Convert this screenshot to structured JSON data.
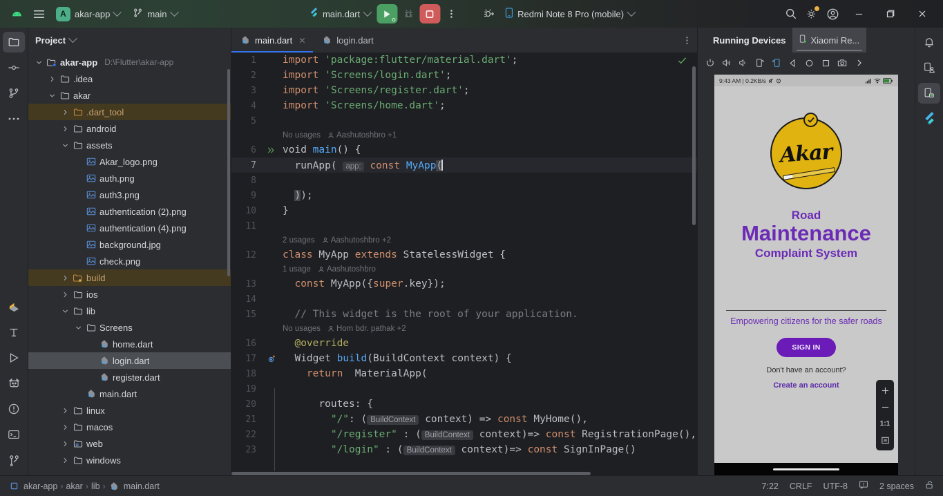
{
  "titlebar": {
    "logo_icon": "android-studio-icon",
    "menu_icon": "hamburger-menu-icon",
    "project_badge": "A",
    "project_name": "akar-app",
    "branch_icon": "git-branch-icon",
    "branch_name": "main",
    "run_config": "main.dart",
    "run_icon": "run-play-icon",
    "debug_icon": "debug-bug-icon",
    "stop_icon": "stop-square-icon",
    "more_icon": "more-vertical-icon",
    "attach_debug_icon": "attach-debugger-icon",
    "device_icon": "phone-icon",
    "device_name": "Redmi Note 8 Pro (mobile)",
    "search_icon": "search-icon",
    "settings_icon": "gear-icon",
    "account_icon": "account-circle-icon",
    "minimize_icon": "minimize-icon",
    "maximize_icon": "maximize-icon",
    "close_icon": "close-icon"
  },
  "left_rail": [
    {
      "name": "project-tool-icon",
      "active": true
    },
    {
      "name": "commit-tool-icon",
      "active": false
    },
    {
      "name": "pull-requests-icon",
      "active": false
    },
    {
      "name": "more-tools-icon",
      "active": false
    }
  ],
  "left_rail_bottom": [
    {
      "name": "flutter-inspector-icon"
    },
    {
      "name": "structure-icon"
    },
    {
      "name": "run-tool-icon"
    },
    {
      "name": "logcat-icon"
    },
    {
      "name": "problems-icon"
    },
    {
      "name": "terminal-icon"
    },
    {
      "name": "version-control-icon"
    }
  ],
  "project_panel": {
    "title": "Project",
    "chevron_icon": "chevron-down-icon",
    "tree": [
      {
        "label": "akar-app",
        "sub": "D:\\Flutter\\akar-app",
        "depth": 0,
        "icon": "module-folder-icon",
        "state": "open",
        "style": "bold"
      },
      {
        "label": ".idea",
        "depth": 1,
        "icon": "folder-icon",
        "state": "closed"
      },
      {
        "label": "akar",
        "depth": 1,
        "icon": "folder-icon",
        "state": "open"
      },
      {
        "label": ".dart_tool",
        "depth": 2,
        "icon": "folder-excluded-icon",
        "state": "closed",
        "style": "orange",
        "row": "highlight"
      },
      {
        "label": "android",
        "depth": 2,
        "icon": "folder-icon",
        "state": "closed"
      },
      {
        "label": "assets",
        "depth": 2,
        "icon": "folder-icon",
        "state": "open"
      },
      {
        "label": "Akar_logo.png",
        "depth": 3,
        "icon": "image-file-icon",
        "state": "leaf"
      },
      {
        "label": "auth.png",
        "depth": 3,
        "icon": "image-file-icon",
        "state": "leaf"
      },
      {
        "label": "auth3.png",
        "depth": 3,
        "icon": "image-file-icon",
        "state": "leaf"
      },
      {
        "label": "authentication (2).png",
        "depth": 3,
        "icon": "image-file-icon",
        "state": "leaf"
      },
      {
        "label": "authentication (4).png",
        "depth": 3,
        "icon": "image-file-icon",
        "state": "leaf"
      },
      {
        "label": "background.jpg",
        "depth": 3,
        "icon": "image-file-icon",
        "state": "leaf"
      },
      {
        "label": "check.png",
        "depth": 3,
        "icon": "image-file-icon",
        "state": "leaf"
      },
      {
        "label": "build",
        "depth": 2,
        "icon": "folder-build-icon",
        "state": "closed",
        "style": "orange",
        "row": "highlight"
      },
      {
        "label": "ios",
        "depth": 2,
        "icon": "folder-icon",
        "state": "closed"
      },
      {
        "label": "lib",
        "depth": 2,
        "icon": "folder-icon",
        "state": "open"
      },
      {
        "label": "Screens",
        "depth": 3,
        "icon": "folder-icon",
        "state": "open"
      },
      {
        "label": "home.dart",
        "depth": 4,
        "icon": "dart-file-icon",
        "state": "leaf"
      },
      {
        "label": "login.dart",
        "depth": 4,
        "icon": "dart-file-icon",
        "state": "leaf",
        "row": "selected"
      },
      {
        "label": "register.dart",
        "depth": 4,
        "icon": "dart-file-icon",
        "state": "leaf"
      },
      {
        "label": "main.dart",
        "depth": 3,
        "icon": "dart-file-icon",
        "state": "leaf"
      },
      {
        "label": "linux",
        "depth": 2,
        "icon": "folder-icon",
        "state": "closed"
      },
      {
        "label": "macos",
        "depth": 2,
        "icon": "folder-icon",
        "state": "closed"
      },
      {
        "label": "web",
        "depth": 2,
        "icon": "folder-web-icon",
        "state": "closed"
      },
      {
        "label": "windows",
        "depth": 2,
        "icon": "folder-icon",
        "state": "closed"
      }
    ]
  },
  "editor": {
    "tabs": [
      {
        "label": "main.dart",
        "icon": "dart-file-icon",
        "active": true,
        "closable": true
      },
      {
        "label": "login.dart",
        "icon": "dart-file-icon",
        "active": false,
        "closable": false
      }
    ],
    "tab_options_icon": "more-vertical-icon",
    "inspection_ok_icon": "checkmark-icon",
    "lines": [
      {
        "n": 1,
        "html": "<span class='kw'>import</span> <span class='str'>'package:flutter/material.dart'</span>;"
      },
      {
        "n": 2,
        "html": "<span class='kw'>import</span> <span class='str'>'Screens/login.dart'</span>;"
      },
      {
        "n": 3,
        "html": "<span class='kw'>import</span> <span class='str'>'Screens/register.dart'</span>;"
      },
      {
        "n": 4,
        "html": "<span class='kw'>import</span> <span class='str'>'Screens/home.dart'</span>;"
      },
      {
        "n": 5,
        "html": ""
      },
      {
        "n": 6,
        "html": "<span class='typ'>void</span> <span class='fn'>main</span>() {",
        "gutter_icon": "run-gutter-icon",
        "hint": {
          "usages": "No usages",
          "author": "Aashutoshbro +1"
        }
      },
      {
        "n": 7,
        "html": "  runApp( <span class='pname'>app:</span> <span class='kw'>const</span> <span class='fn'>MyApp</span><span class='sel'>(</span><span class='caret'></span>",
        "current": true
      },
      {
        "n": 8,
        "html": ""
      },
      {
        "n": 9,
        "html": "  <span class='sel'>)</span>);"
      },
      {
        "n": 10,
        "html": "}"
      },
      {
        "n": 11,
        "html": ""
      },
      {
        "n": 12,
        "html": "<span class='kw'>class</span> <span class='typ'>MyApp</span> <span class='kw'>extends</span> <span class='typ'>StatelessWidget</span> {",
        "hint": {
          "usages": "2 usages",
          "author": "Aashutoshbro +2"
        }
      },
      {
        "n": 13,
        "html": "  <span class='kw'>const</span> <span class='typ'>MyApp</span>({<span class='kw'>super</span>.key});",
        "hint": {
          "usages": "1 usage",
          "author": "Aashutoshbro"
        }
      },
      {
        "n": 14,
        "html": ""
      },
      {
        "n": 15,
        "html": "  <span class='cmt'>// This widget is the root of your application.</span>"
      },
      {
        "n": 16,
        "html": "  <span class='ann'>@override</span>",
        "hint": {
          "usages": "No usages",
          "author": "Hom bdr. pathak +2"
        }
      },
      {
        "n": 17,
        "html": "  <span class='typ'>Widget</span> <span class='fn'>build</span>(<span class='typ'>BuildContext</span> context) {",
        "gutter_icon": "override-gutter-icon"
      },
      {
        "n": 18,
        "html": "    <span class='kw'>return</span>  <span class='typ'>MaterialApp</span>("
      },
      {
        "n": 19,
        "html": ""
      },
      {
        "n": 20,
        "html": "      routes: {"
      },
      {
        "n": 21,
        "html": "        <span class='str'>\"/\"</span>: (<span class='ctxchip'>BuildContext</span> context) =&gt; <span class='kw'>const</span> <span class='typ'>MyHome</span>(),"
      },
      {
        "n": 22,
        "html": "        <span class='str'>\"/register\"</span> : (<span class='ctxchip'>BuildContext</span> context)=&gt; <span class='kw'>const</span> <span class='typ'>RegistrationPage</span>(),"
      },
      {
        "n": 23,
        "html": "        <span class='str'>\"/login\"</span> : (<span class='ctxchip'>BuildContext</span> context)=&gt; <span class='kw'>const</span> <span class='typ'>SignInPage</span>()"
      }
    ]
  },
  "devices_panel": {
    "tabs": [
      {
        "label": "Running Devices",
        "primary": true
      },
      {
        "label": "Xiaomi Re...",
        "icon": "device-running-icon",
        "selected": true
      }
    ],
    "toolbar": [
      {
        "name": "power-icon"
      },
      {
        "name": "volume-up-icon"
      },
      {
        "name": "volume-down-icon"
      },
      {
        "name": "rotate-left-icon"
      },
      {
        "name": "rotate-right-icon"
      },
      {
        "name": "back-icon"
      },
      {
        "name": "home-icon"
      },
      {
        "name": "overview-icon"
      },
      {
        "name": "screenshot-icon"
      },
      {
        "name": "more-chevron-icon"
      }
    ],
    "phone": {
      "status_left": "9:43 AM | 0.2KB/s",
      "status_icons_left": [
        "mute-icon",
        "alarm-icon"
      ],
      "status_icons_right": [
        "signal-icon",
        "wifi-icon",
        "battery-charging-icon"
      ],
      "logo_text": "Akar",
      "title_line1": "Road",
      "title_line2": "Maintenance",
      "title_line3": "Complaint System",
      "tagline": "Empowering citizens for the safer roads",
      "signin_button": "SIGN IN",
      "no_account_text": "Don't have an account?",
      "create_account_link": "Create an account",
      "accent_purple": "#6b2bb5",
      "logo_yellow": "#e0b310",
      "screen_bg": "#c9c9c9"
    },
    "zoom_controls": {
      "zoom_in_icon": "plus-icon",
      "zoom_out_icon": "minus-icon",
      "zoom_ratio": "1:1",
      "fit_icon": "fit-screen-icon"
    }
  },
  "right_rail": [
    {
      "name": "notifications-bell-icon",
      "active": false
    },
    {
      "name": "device-manager-icon",
      "active": false
    },
    {
      "name": "running-devices-icon",
      "active": true
    },
    {
      "name": "flutter-icon",
      "active": false
    }
  ],
  "statusbar": {
    "breadcrumb": [
      {
        "label": "akar-app",
        "icon": "project-icon"
      },
      {
        "label": "akar"
      },
      {
        "label": "lib"
      },
      {
        "label": "main.dart",
        "icon": "dart-file-icon"
      }
    ],
    "caret_position": "7:22",
    "line_separator": "CRLF",
    "encoding": "UTF-8",
    "inspection_icon": "inspection-widget-icon",
    "indent": "2 spaces",
    "lock_icon": "unlocked-icon"
  }
}
